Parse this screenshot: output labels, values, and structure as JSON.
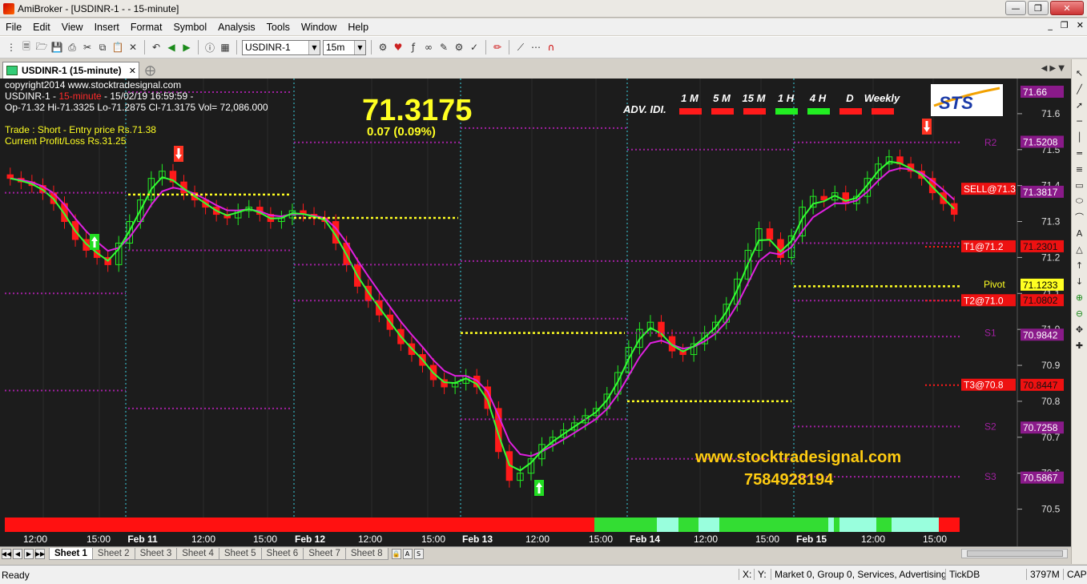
{
  "window": {
    "app_name": "AmiBroker",
    "title": "AmiBroker - [USDINR-1 -  - 15-minute]"
  },
  "menu": [
    "File",
    "Edit",
    "View",
    "Insert",
    "Format",
    "Symbol",
    "Analysis",
    "Tools",
    "Window",
    "Help"
  ],
  "toolbar": {
    "symbol": "USDINR-1",
    "interval": "15m"
  },
  "doc_tab": {
    "label": "USDINR-1 (15-minute)"
  },
  "chart_info": {
    "copyright": "copyright2014 www.stocktradesignal.com",
    "symbol_prefix": "USDINR-1 - ",
    "interval_text": "15-minute",
    "symbol_suffix": " - 15/02/19 16:59:59 -",
    "ohlc": "Op-71.32  Hi-71.3325  Lo-71.2875  Cl-71.3175  Vol= 72,086.000",
    "trade_line": "Trade : Short - Entry price Rs.71.38",
    "pl_line": "Current Profit/Loss Rs.31.25",
    "big_price": "71.3175",
    "change": "0.07 (0.09%)",
    "website": "www.stocktradesignal.com",
    "phone": "7584928194",
    "logo_text": "STS"
  },
  "adv_indicator": {
    "label": "ADV. IDI.",
    "timeframes": [
      {
        "name": "1 M",
        "color": "#ff1a1a"
      },
      {
        "name": "5 M",
        "color": "#ff1a1a"
      },
      {
        "name": "15 M",
        "color": "#ff1a1a"
      },
      {
        "name": "1 H",
        "color": "#22ee22"
      },
      {
        "name": "4 H",
        "color": "#22ee22"
      },
      {
        "name": "D",
        "color": "#ff1a1a"
      },
      {
        "name": "Weekly",
        "color": "#ff1a1a"
      }
    ]
  },
  "levels": {
    "r2": "R2",
    "s1": "S1",
    "s2": "S2",
    "s3": "S3",
    "pivot": "Pivot",
    "sell": "SELL@71.3",
    "t1": "T1@71.2",
    "t2": "T2@71.0",
    "t3": "T3@70.8"
  },
  "price_axis": {
    "ticks": [
      "71.6",
      "71.5",
      "71.4",
      "71.3",
      "71.2",
      "71.1",
      "71.0",
      "70.9",
      "70.8",
      "70.7",
      "70.6",
      "70.5"
    ],
    "boxes": [
      {
        "text": "71.66",
        "bg": "#8a1a8a",
        "fg": "#ffffff"
      },
      {
        "text": "71.5208",
        "bg": "#8a1a8a",
        "fg": "#ffffff"
      },
      {
        "text": "71.3817",
        "bg": "#8a1a8a",
        "fg": "#ffffff"
      },
      {
        "text": "71.2301",
        "bg": "#ee1111",
        "fg": "#111111"
      },
      {
        "text": "71.1233",
        "bg": "#ffff22",
        "fg": "#000000"
      },
      {
        "text": "71.0802",
        "bg": "#ee1111",
        "fg": "#111111"
      },
      {
        "text": "70.9842",
        "bg": "#8a1a8a",
        "fg": "#ffffff"
      },
      {
        "text": "70.8447",
        "bg": "#ee1111",
        "fg": "#111111"
      },
      {
        "text": "70.7258",
        "bg": "#8a1a8a",
        "fg": "#ffffff"
      },
      {
        "text": "70.5867",
        "bg": "#8a1a8a",
        "fg": "#ffffff"
      }
    ]
  },
  "time_axis": [
    "12:00",
    "15:00",
    "Feb 11",
    "12:00",
    "15:00",
    "Feb 12",
    "12:00",
    "15:00",
    "Feb 13",
    "12:00",
    "15:00",
    "Feb 14",
    "12:00",
    "15:00",
    "Feb 15",
    "12:00",
    "15:00"
  ],
  "sheets": [
    "Sheet 1",
    "Sheet 2",
    "Sheet 3",
    "Sheet 4",
    "Sheet 5",
    "Sheet 6",
    "Sheet 7",
    "Sheet 8"
  ],
  "status": {
    "ready": "Ready",
    "x": "X:",
    "y": "Y:",
    "market": "Market 0, Group 0, Services, Advertising",
    "db": "TickDB",
    "mem": "3797M",
    "cap": "CAP"
  },
  "chart_data": {
    "type": "candlestick",
    "ylim": [
      70.45,
      71.68
    ],
    "series": [
      {
        "name": "price_close",
        "values": [
          71.42,
          71.41,
          71.4,
          71.38,
          71.35,
          71.3,
          71.25,
          71.22,
          71.2,
          71.18,
          71.24,
          71.3,
          71.36,
          71.42,
          71.44,
          71.41,
          71.38,
          71.36,
          71.34,
          71.32,
          71.31,
          71.33,
          71.34,
          71.32,
          71.3,
          71.31,
          71.33,
          71.32,
          71.31,
          71.3,
          71.24,
          71.18,
          71.12,
          71.08,
          71.04,
          71.0,
          70.96,
          70.93,
          70.9,
          70.86,
          70.84,
          70.85,
          70.87,
          70.84,
          70.78,
          70.66,
          70.58,
          70.6,
          70.64,
          70.68,
          70.7,
          70.72,
          70.74,
          70.76,
          70.78,
          70.82,
          70.88,
          70.95,
          71.0,
          71.02,
          70.98,
          70.94,
          70.93,
          70.96,
          70.99,
          71.02,
          71.07,
          71.14,
          71.22,
          71.28,
          71.25,
          71.2,
          71.26,
          71.34,
          71.37,
          71.36,
          71.38,
          71.35,
          71.37,
          71.42,
          71.46,
          71.48,
          71.46,
          71.44,
          71.42,
          71.38,
          71.35,
          71.32
        ]
      }
    ]
  }
}
